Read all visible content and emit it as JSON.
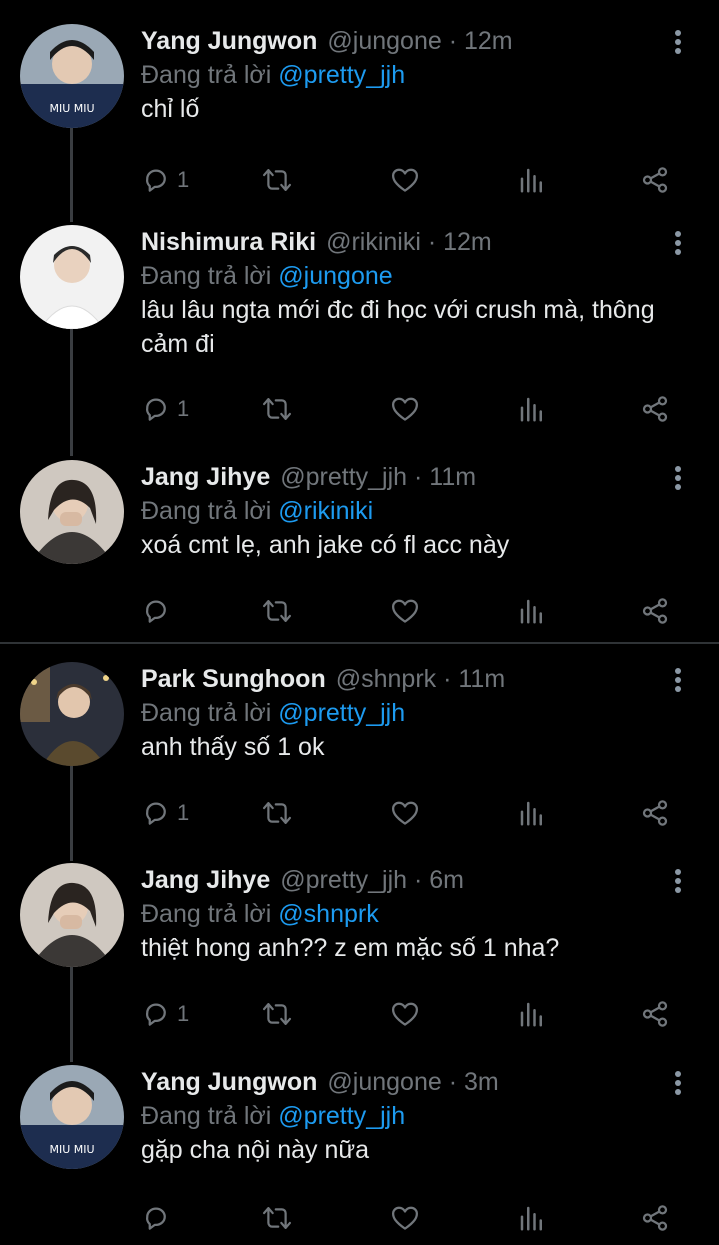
{
  "replying_prefix": "Đang trả lời",
  "tweets": [
    {
      "name": "Yang Jungwon",
      "handle": "@jungone",
      "time": "12m",
      "reply_to": "@pretty_jjh",
      "text": "chỉ lố",
      "reply_count": "1"
    },
    {
      "name": "Nishimura Riki",
      "handle": "@rikiniki",
      "time": "12m",
      "reply_to": "@jungone",
      "text": "lâu lâu ngta mới đc đi học với crush mà, thông cảm đi",
      "reply_count": "1"
    },
    {
      "name": "Jang Jihye",
      "handle": "@pretty_jjh",
      "time": "11m",
      "reply_to": "@rikiniki",
      "text": "xoá cmt lẹ, anh jake có fl acc này",
      "reply_count": ""
    },
    {
      "name": "Park Sunghoon",
      "handle": "@shnprk",
      "time": "11m",
      "reply_to": "@pretty_jjh",
      "text": "anh thấy số 1 ok",
      "reply_count": "1"
    },
    {
      "name": "Jang Jihye",
      "handle": "@pretty_jjh",
      "time": "6m",
      "reply_to": "@shnprk",
      "text": "thiệt hong anh?? z em mặc số 1 nha?",
      "reply_count": "1"
    },
    {
      "name": "Yang Jungwon",
      "handle": "@jungone",
      "time": "3m",
      "reply_to": "@pretty_jjh",
      "text": "gặp cha nội này nữa",
      "reply_count": ""
    }
  ],
  "icons": {
    "reply": "reply-icon",
    "retweet": "retweet-icon",
    "like": "like-icon",
    "views": "views-icon",
    "share": "share-icon",
    "more": "more-icon"
  },
  "colors": {
    "background": "#000000",
    "text": "#e7e9ea",
    "muted": "#71767b",
    "mention": "#1d9bf0",
    "divider": "#2f3336"
  }
}
